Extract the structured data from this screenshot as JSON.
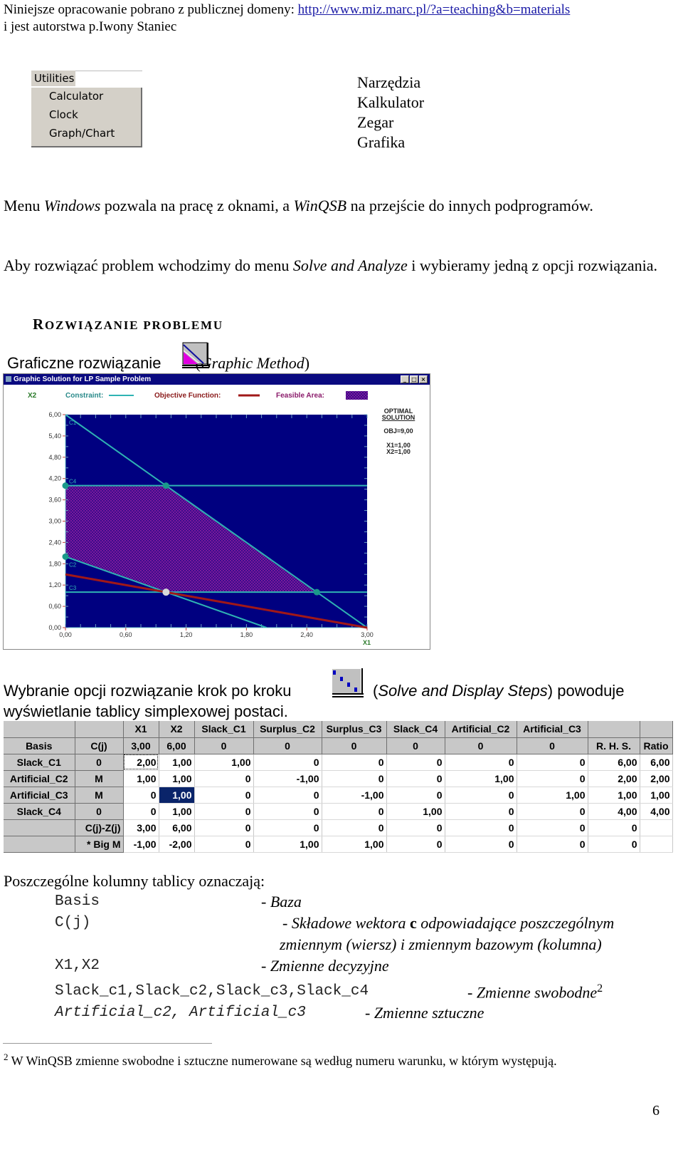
{
  "header": {
    "line1_text": "Niniejsze opracowanie pobrano z publicznej domeny: ",
    "line1_link": "http://www.miz.marc.pl/?a=teaching&b=materials",
    "line2": "i jest autorstwa p.Iwony Staniec"
  },
  "utilities_menu": {
    "title": "Utilities",
    "items": [
      "Calculator",
      "Clock",
      "Graph/Chart"
    ]
  },
  "translations": [
    "Narzędzia",
    "Kalkulator",
    "Zegar",
    "Grafika"
  ],
  "paragraph1": {
    "t1": "Menu ",
    "t2": "Windows",
    "t3": " pozwala na pracę z oknami, a ",
    "t4": "WinQSB",
    "t5": " na przejście do innych podprogramów."
  },
  "paragraph2": {
    "t1": "Aby rozwiązać problem wchodzimy do menu ",
    "t2": "Solve and Analyze",
    "t3": " i wybieramy jedną z opcji rozwiązania."
  },
  "section_title": {
    "first": "R",
    "rest1": "OZWI",
    "big2": "Ą",
    "rest2": "ZANIE PROBLEMU"
  },
  "graphic_method": {
    "label": "Graficzne rozwiązanie",
    "paren_open": "(",
    "english": "Graphic Method",
    "paren_close": ")"
  },
  "graph_window": {
    "title": "Graphic Solution for LP Sample Problem",
    "buttons": [
      "_",
      "□",
      "×"
    ],
    "legend": {
      "y_axis": "X2",
      "constraint": "Constraint:",
      "objective": "Objective Function:",
      "feasible": "Feasible Area:"
    },
    "optimal": {
      "line1": "OPTIMAL",
      "line2": "SOLUTION",
      "obj": "OBJ=9,00",
      "x1": "X1=1,00",
      "x2": "X2=1,00"
    },
    "colors": {
      "plot_bg": "#000080",
      "constraint": "#2fb3b3",
      "objective": "#a01818",
      "feasible": "#5a148c"
    }
  },
  "chart_data": {
    "type": "line",
    "title": "Graphic Solution for LP Sample Problem",
    "xlabel": "X1",
    "ylabel": "X2",
    "xlim": [
      0,
      3
    ],
    "ylim": [
      0,
      6
    ],
    "x_ticks": [
      "0,00",
      "0,60",
      "1,20",
      "1,80",
      "2,40",
      "3,00"
    ],
    "y_ticks": [
      "0,00",
      "0,60",
      "1,20",
      "1,80",
      "2,40",
      "3,00",
      "3,60",
      "4,20",
      "4,80",
      "5,40",
      "6,00"
    ],
    "x_tick_values": [
      0,
      0.6,
      1.2,
      1.8,
      2.4,
      3.0
    ],
    "y_tick_values": [
      0,
      0.6,
      1.2,
      1.8,
      2.4,
      3.0,
      3.6,
      4.2,
      4.8,
      5.4,
      6.0
    ],
    "constraints": [
      {
        "name": "C1",
        "points": [
          [
            0,
            6
          ],
          [
            3,
            0
          ]
        ]
      },
      {
        "name": "C2",
        "points": [
          [
            0,
            2
          ],
          [
            2,
            0
          ]
        ]
      },
      {
        "name": "C3",
        "points": [
          [
            0,
            1
          ],
          [
            3,
            1
          ]
        ]
      },
      {
        "name": "C4",
        "points": [
          [
            0,
            4
          ],
          [
            3,
            4
          ]
        ]
      }
    ],
    "objective": {
      "name": "Objective Function",
      "points": [
        [
          0,
          1.5
        ],
        [
          3,
          0
        ]
      ]
    },
    "feasible_area": [
      [
        0,
        4
      ],
      [
        1,
        4
      ],
      [
        2.5,
        1
      ],
      [
        1,
        1
      ],
      [
        0,
        2
      ]
    ],
    "vertices": [
      [
        0,
        4
      ],
      [
        1,
        4
      ],
      [
        0,
        2
      ],
      [
        2.5,
        1
      ]
    ],
    "optimal_point": [
      1,
      1
    ],
    "legend": [
      "Constraint",
      "Objective Function",
      "Feasible Area"
    ],
    "legend_position": "top"
  },
  "simplex_text": {
    "line1a": "Wybranie opcji rozwiązanie  krok po kroku",
    "paren_open": "(",
    "english": "Solve and Display Steps",
    "line1b": ") powoduje",
    "line2": "wyświetlanie tablicy simplexowej postaci."
  },
  "tableau": {
    "header_row": [
      "",
      "",
      "X1",
      "X2",
      "Slack_C1",
      "Surplus_C2",
      "Surplus_C3",
      "Slack_C4",
      "Artificial_C2",
      "Artificial_C3",
      "",
      ""
    ],
    "cj_row": [
      "Basis",
      "C(j)",
      "3,00",
      "6,00",
      "0",
      "0",
      "0",
      "0",
      "0",
      "0",
      "R. H. S.",
      "Ratio"
    ],
    "rows": [
      [
        "Slack_C1",
        "0",
        "2,00",
        "1,00",
        "1,00",
        "0",
        "0",
        "0",
        "0",
        "0",
        "6,00",
        "6,00"
      ],
      [
        "Artificial_C2",
        "M",
        "1,00",
        "1,00",
        "0",
        "-1,00",
        "0",
        "0",
        "1,00",
        "0",
        "2,00",
        "2,00"
      ],
      [
        "Artificial_C3",
        "M",
        "0",
        "1,00",
        "0",
        "0",
        "-1,00",
        "0",
        "0",
        "1,00",
        "1,00",
        "1,00"
      ],
      [
        "Slack_C4",
        "0",
        "0",
        "1,00",
        "0",
        "0",
        "0",
        "1,00",
        "0",
        "0",
        "4,00",
        "4,00"
      ]
    ],
    "bottom_rows": [
      [
        "",
        "C(j)-Z(j)",
        "3,00",
        "6,00",
        "0",
        "0",
        "0",
        "0",
        "0",
        "0",
        "0",
        ""
      ],
      [
        "",
        "* Big M",
        "-1,00",
        "-2,00",
        "0",
        "1,00",
        "1,00",
        "0",
        "0",
        "0",
        "0",
        ""
      ]
    ]
  },
  "definitions": {
    "title": "Poszczególne kolumny tablicy oznaczają:",
    "items": [
      {
        "key": "Basis",
        "value": "- Baza"
      },
      {
        "key": "C(j)",
        "value_a": "-  Składowe wektora ",
        "value_b": "c",
        "value_c": " odpowiadające poszczególnym",
        "value_line2": "zmiennym (wiersz) i zmiennym bazowym (kolumna)"
      },
      {
        "key": "X1,X2",
        "value": "- Zmienne decyzyjne"
      },
      {
        "key": "Slack_c1,Slack_c2,Slack_c3,Slack_c4",
        "value": "- Zmienne swobodne",
        "sup": "2"
      },
      {
        "key": "Artificial_c2, Artificial_c3",
        "value": "- Zmienne sztuczne"
      }
    ]
  },
  "footnote": {
    "mark": "2",
    "text": " W WinQSB zmienne swobodne i sztuczne numerowane są według numeru warunku, w którym występują."
  },
  "page_number": "6"
}
